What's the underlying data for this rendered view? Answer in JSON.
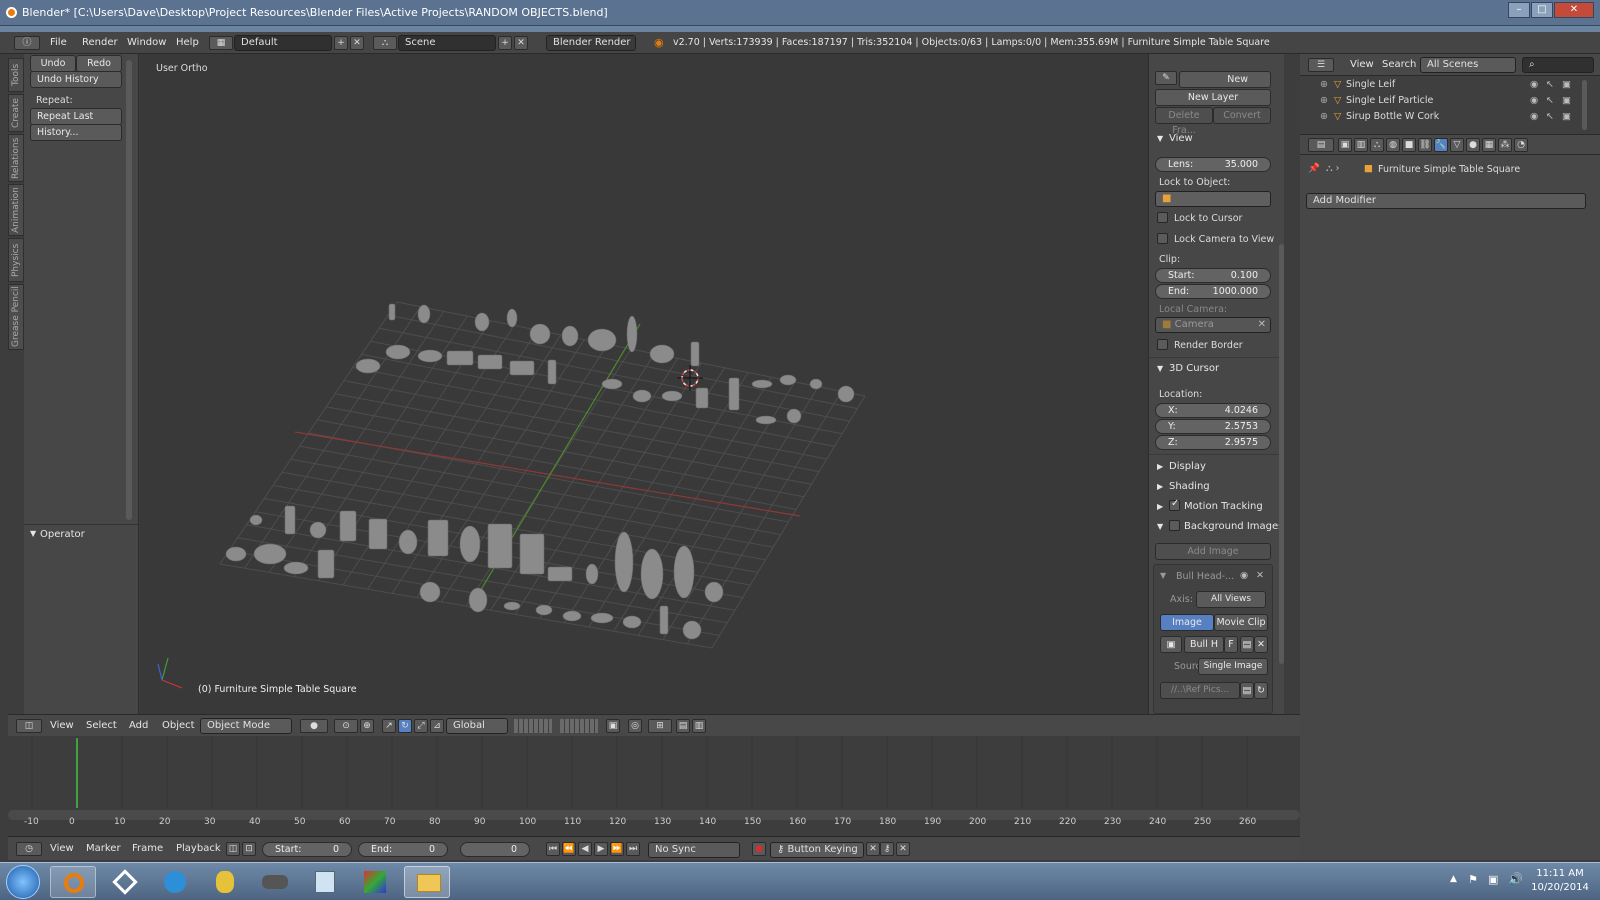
{
  "titlebar": {
    "title": "Blender* [C:\\Users\\Dave\\Desktop\\Project Resources\\Blender Files\\Active Projects\\RANDOM OBJECTS.blend]"
  },
  "info": {
    "menus": [
      "File",
      "Render",
      "Window",
      "Help"
    ],
    "layout": "Default",
    "scene": "Scene",
    "engine": "Blender Render",
    "stats": "v2.70 | Verts:173939 | Faces:187197 | Tris:352104 | Objects:0/63 | Lamps:0/0 | Mem:355.69M | Furniture Simple Table Square"
  },
  "tool_tabs": [
    "Tools",
    "Create",
    "Relations",
    "Animation",
    "Physics",
    "Grease Pencil"
  ],
  "tools": {
    "undo": "Undo",
    "redo": "Redo",
    "undo_history": "Undo History",
    "repeat_label": "Repeat:",
    "repeat_last": "Repeat Last",
    "history": "History...",
    "operator": "Operator"
  },
  "viewport": {
    "view_name": "User Ortho",
    "object_label": "(0) Furniture Simple Table Square"
  },
  "npanel": {
    "gp_new": "New",
    "gp_new_layer": "New Layer",
    "gp_delete": "Delete Fra...",
    "gp_convert": "Convert",
    "view_header": "View",
    "lens_label": "Lens:",
    "lens_value": "35.000",
    "lock_object_label": "Lock to Object:",
    "lock_cursor": "Lock to Cursor",
    "lock_camera": "Lock Camera to View",
    "clip_label": "Clip:",
    "clip_start_label": "Start:",
    "clip_start": "0.100",
    "clip_end_label": "End:",
    "clip_end": "1000.000",
    "local_camera_label": "Local Camera:",
    "camera_value": "Camera",
    "render_border": "Render Border",
    "cursor_header": "3D Cursor",
    "location_label": "Location:",
    "x_label": "X:",
    "x": "4.0246",
    "y_label": "Y:",
    "y": "2.5753",
    "z_label": "Z:",
    "z": "2.9575",
    "display": "Display",
    "shading": "Shading",
    "motion_tracking": "Motion Tracking",
    "background_images": "Background Images",
    "add_image": "Add Image",
    "bg_name": "Bull Head-...",
    "axis_label": "Axis:",
    "axis_value": "All Views",
    "tab_image": "Image",
    "tab_movie": "Movie Clip",
    "img_name": "Bull H",
    "img_f": "F",
    "source_label": "Source",
    "source_value": "Single Image",
    "path": "//..\\Ref Pics..."
  },
  "vpheader": {
    "menus": [
      "View",
      "Select",
      "Add",
      "Object"
    ],
    "mode": "Object Mode",
    "orientation": "Global"
  },
  "timeline": {
    "ticks": [
      "-10",
      "0",
      "10",
      "20",
      "30",
      "40",
      "50",
      "60",
      "70",
      "80",
      "90",
      "100",
      "110",
      "120",
      "130",
      "140",
      "150",
      "160",
      "170",
      "180",
      "190",
      "200",
      "210",
      "220",
      "230",
      "240",
      "250",
      "260"
    ],
    "current_frame": 0
  },
  "tlheader": {
    "menus": [
      "View",
      "Marker",
      "Frame",
      "Playback"
    ],
    "start_label": "Start:",
    "start": "0",
    "end_label": "End:",
    "end": "0",
    "current": "0",
    "sync": "No Sync",
    "keying": "Button Keying ..."
  },
  "outliner": {
    "view": "View",
    "search": "Search",
    "scenes": "All Scenes",
    "items": [
      "Single Leif",
      "Single Leif Particle",
      "Sirup Bottle W Cork"
    ]
  },
  "props": {
    "object_name": "Furniture Simple Table Square",
    "add_modifier": "Add Modifier"
  },
  "taskbar": {
    "time": "11:11 AM",
    "date": "10/20/2014"
  },
  "colors": {
    "accent": "#5680c2",
    "x_axis": "#9b3a3a",
    "y_axis": "#4f8a2f",
    "frame_marker": "#3ea33e"
  }
}
